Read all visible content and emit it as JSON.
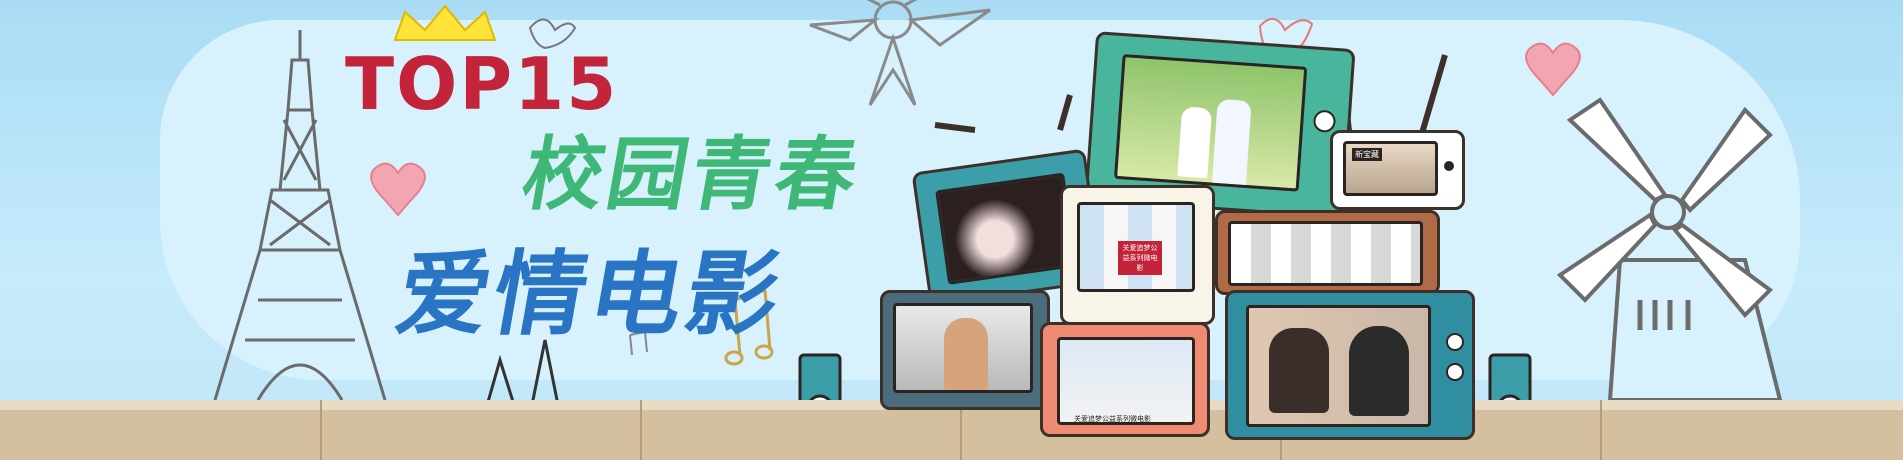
{
  "banner": {
    "headline_top": "TOP15",
    "headline_line1": "校园青春",
    "headline_line2": "爱情电影"
  },
  "tv_captions": {
    "tv_small_badge": "新宝藏",
    "tv_mid_badge": "关爱追梦公益系列微电影",
    "tv_bottom_caption": "关爱追梦公益系列微电影"
  },
  "colors": {
    "top_red": "#c4243a",
    "line1_green": "#3fb877",
    "line2_blue": "#2a74c4",
    "sky": "#bfe6f8"
  }
}
